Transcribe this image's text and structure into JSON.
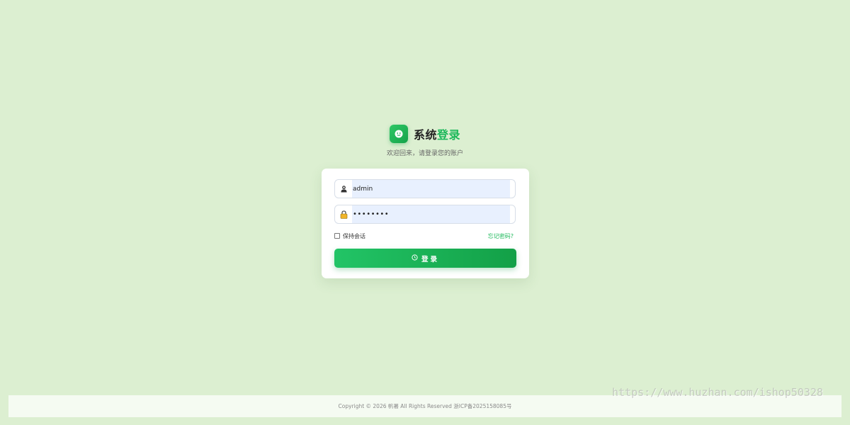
{
  "header": {
    "title_part1": "系统",
    "title_part2": "登录",
    "subtitle": "欢迎回来，请登录您的账户",
    "logo_icon": "smiley-icon"
  },
  "form": {
    "username": {
      "value": "admin",
      "icon": "user-icon"
    },
    "password": {
      "value": "••••••••",
      "icon": "lock-icon"
    },
    "keep_session_label": "保持会话",
    "keep_session_checked": false,
    "forgot_label": "忘记密码?",
    "login_label": "登录",
    "login_icon": "clock-icon"
  },
  "footer": {
    "copyright": "Copyright © 2026 帆署 All Rights Reserved 浙ICP备2025158085号"
  },
  "watermark": "https://www.huzhan.com/ishop50328",
  "colors": {
    "background": "#dcefd1",
    "accent": "#1cb85a",
    "button": "#13a047",
    "input_fill": "#e8f0fe"
  }
}
